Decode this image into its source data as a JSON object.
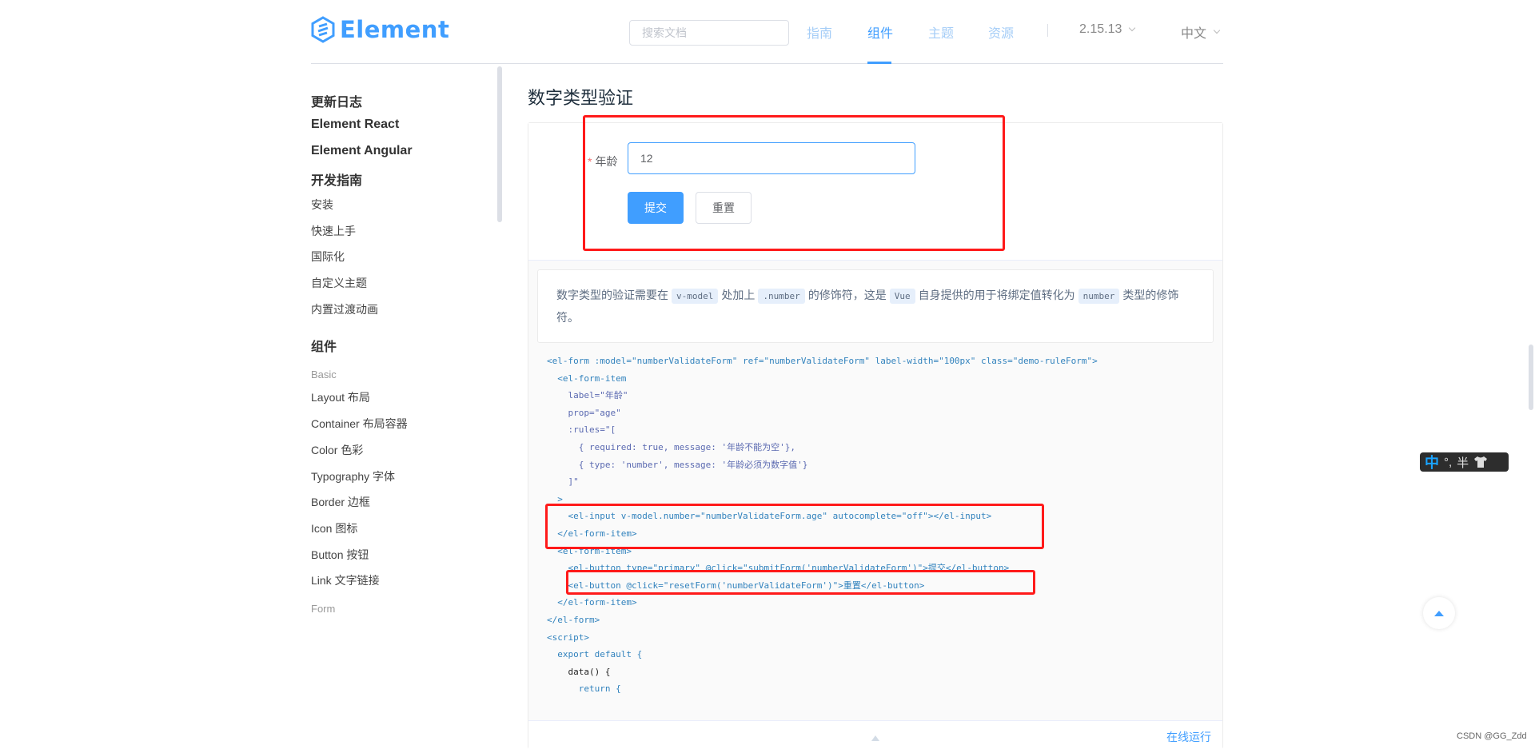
{
  "header": {
    "logo_text": "Element",
    "search_placeholder": "搜索文档",
    "nav": [
      {
        "label": "指南",
        "active": false
      },
      {
        "label": "组件",
        "active": true
      },
      {
        "label": "主题",
        "active": false
      },
      {
        "label": "资源",
        "active": false
      }
    ],
    "version": "2.15.13",
    "language": "中文"
  },
  "sidebar": {
    "items": [
      {
        "label": "更新日志",
        "type": "h1"
      },
      {
        "label": "Element React",
        "type": "h1"
      },
      {
        "label": "Element Angular",
        "type": "h1"
      },
      {
        "label": "开发指南",
        "type": "h1"
      },
      {
        "label": "安装",
        "type": "link"
      },
      {
        "label": "快速上手",
        "type": "link"
      },
      {
        "label": "国际化",
        "type": "link"
      },
      {
        "label": "自定义主题",
        "type": "link"
      },
      {
        "label": "内置过渡动画",
        "type": "link"
      },
      {
        "label": "组件",
        "type": "h1"
      },
      {
        "label": "Basic",
        "type": "h2"
      },
      {
        "label": "Layout 布局",
        "type": "link"
      },
      {
        "label": "Container 布局容器",
        "type": "link"
      },
      {
        "label": "Color 色彩",
        "type": "link"
      },
      {
        "label": "Typography 字体",
        "type": "link"
      },
      {
        "label": "Border 边框",
        "type": "link"
      },
      {
        "label": "Icon 图标",
        "type": "link"
      },
      {
        "label": "Button 按钮",
        "type": "link"
      },
      {
        "label": "Link 文字链接",
        "type": "link"
      },
      {
        "label": "Form",
        "type": "h2"
      }
    ]
  },
  "main": {
    "title": "数字类型验证",
    "form": {
      "required_mark": "*",
      "age_label": "年龄",
      "age_value": "12",
      "submit_label": "提交",
      "reset_label": "重置"
    },
    "description": {
      "parts": [
        "数字类型的验证需要在",
        "v-model",
        "处加上",
        ".number",
        "的修饰符，这是",
        "Vue",
        "自身提供的用于将绑定值转化为",
        "number",
        "类型的修饰符。"
      ]
    },
    "code_lines": [
      "<el-form :model=\"numberValidateForm\" ref=\"numberValidateForm\" label-width=\"100px\" class=\"demo-ruleForm\">",
      "  <el-form-item",
      "    label=\"年龄\"",
      "    prop=\"age\"",
      "    :rules=\"[",
      "      { required: true, message: '年龄不能为空'},",
      "      { type: 'number', message: '年龄必须为数字值'}",
      "    ]\"",
      "  >",
      "    <el-input v-model.number=\"numberValidateForm.age\" autocomplete=\"off\"></el-input>",
      "  </el-form-item>",
      "  <el-form-item>",
      "    <el-button type=\"primary\" @click=\"submitForm('numberValidateForm')\">提交</el-button>",
      "    <el-button @click=\"resetForm('numberValidateForm')\">重置</el-button>",
      "  </el-form-item>",
      "</el-form>",
      "<script>",
      "  export default {",
      "    data() {",
      "      return {"
    ],
    "online_run_label": "在线运行"
  },
  "ime": {
    "mode": "中",
    "punct": "°,",
    "width": "半"
  },
  "watermark": "CSDN @GG_Zdd",
  "colors": {
    "primary": "#409eff",
    "annotation": "#ff1a1a"
  }
}
